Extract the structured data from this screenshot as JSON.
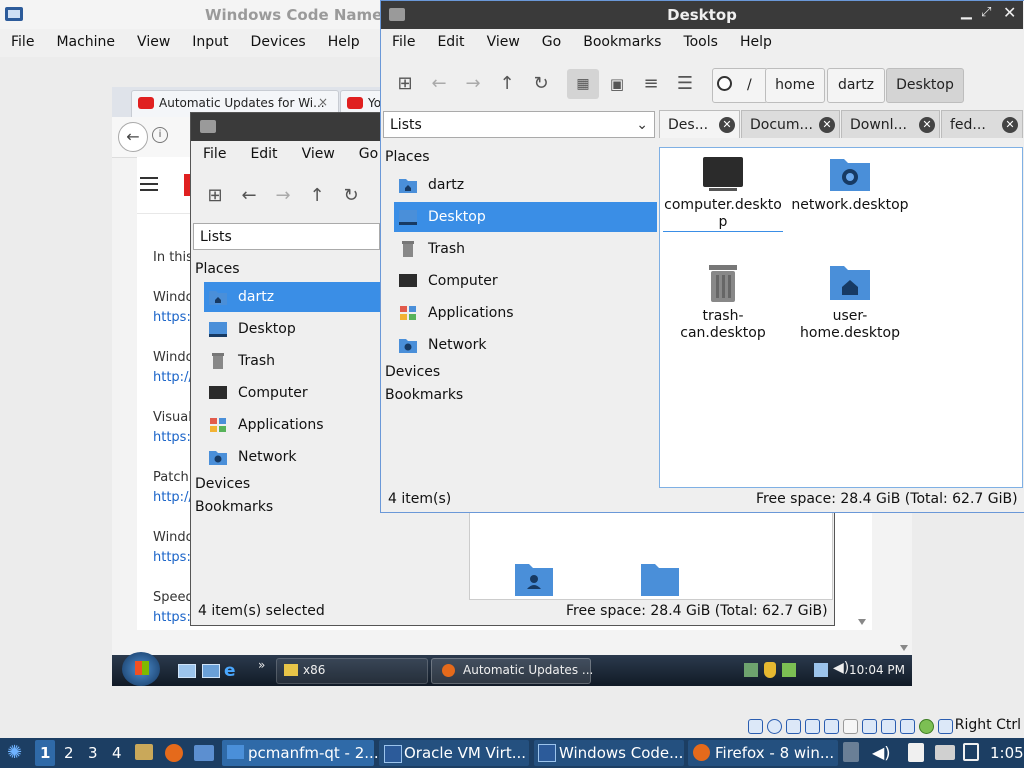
{
  "vbox": {
    "title": "Windows Code Name",
    "menu": [
      "File",
      "Machine",
      "View",
      "Input",
      "Devices",
      "Help"
    ],
    "status_right": "Right Ctrl"
  },
  "guest": {
    "firefox": {
      "tabs": [
        {
          "label": "Automatic Updates for Wi..."
        },
        {
          "label": "Yo"
        }
      ],
      "page_lines": [
        {
          "text": "In this",
          "kind": "text"
        },
        {
          "text": "Windo",
          "kind": "text"
        },
        {
          "text": "https:/",
          "kind": "link"
        },
        {
          "text": "Windo",
          "kind": "text"
        },
        {
          "text": "http://",
          "kind": "link"
        },
        {
          "text": "Visual",
          "kind": "text"
        },
        {
          "text": "https:/",
          "kind": "link"
        },
        {
          "text": "Patch",
          "kind": "text"
        },
        {
          "text": "http://",
          "kind": "link"
        },
        {
          "text": "Windo",
          "kind": "text"
        },
        {
          "text": "https:/",
          "kind": "link"
        },
        {
          "text": "Speed",
          "kind": "text"
        },
        {
          "text": "https:/",
          "kind": "link"
        }
      ]
    },
    "taskbar": {
      "folder_label": "x86",
      "firefox_label": "Automatic Updates ...",
      "time": "10:04 PM"
    }
  },
  "fm_back": {
    "menu": [
      "File",
      "Edit",
      "View",
      "Go"
    ],
    "places_combo": "Lists",
    "places_header": "Places",
    "places": [
      {
        "label": "dartz",
        "icon": "home-folder-icon",
        "selected": true
      },
      {
        "label": "Desktop",
        "icon": "desktop-icon",
        "selected": false
      },
      {
        "label": "Trash",
        "icon": "trash-icon",
        "selected": false
      },
      {
        "label": "Computer",
        "icon": "computer-icon",
        "selected": false
      },
      {
        "label": "Applications",
        "icon": "applications-icon",
        "selected": false
      },
      {
        "label": "Network",
        "icon": "network-icon",
        "selected": false
      }
    ],
    "devices": "Devices",
    "bookmarks": "Bookmarks",
    "status_left": "4 item(s) selected",
    "status_right": "Free space: 28.4 GiB (Total: 62.7 GiB)"
  },
  "fm_front": {
    "title": "Desktop",
    "menu": [
      "File",
      "Edit",
      "View",
      "Go",
      "Bookmarks",
      "Tools",
      "Help"
    ],
    "path": [
      "/",
      "home",
      "dartz",
      "Desktop"
    ],
    "places_combo": "Lists",
    "places_header": "Places",
    "places": [
      {
        "label": "dartz",
        "icon": "home-folder-icon",
        "selected": false
      },
      {
        "label": "Desktop",
        "icon": "desktop-icon",
        "selected": true
      },
      {
        "label": "Trash",
        "icon": "trash-icon",
        "selected": false
      },
      {
        "label": "Computer",
        "icon": "computer-icon",
        "selected": false
      },
      {
        "label": "Applications",
        "icon": "applications-icon",
        "selected": false
      },
      {
        "label": "Network",
        "icon": "network-icon",
        "selected": false
      }
    ],
    "devices": "Devices",
    "bookmarks": "Bookmarks",
    "tabs": [
      "Des...",
      "Docum...",
      "Downl...",
      "fed..."
    ],
    "files": [
      {
        "label_lines": [
          "computer.deskto",
          "p"
        ],
        "icon": "computer-icon"
      },
      {
        "label_lines": [
          "network.desktop"
        ],
        "icon": "network-folder-icon"
      },
      {
        "label_lines": [
          "trash-",
          "can.desktop"
        ],
        "icon": "trash-icon"
      },
      {
        "label_lines": [
          "user-",
          "home.desktop"
        ],
        "icon": "home-folder-icon"
      }
    ],
    "status_left": "4 item(s)",
    "status_right": "Free space: 28.4 GiB (Total: 62.7 GiB)"
  },
  "host_taskbar": {
    "workspaces": [
      "1",
      "2",
      "3",
      "4"
    ],
    "tasks": [
      {
        "label": "pcmanfm-qt - 2..."
      },
      {
        "label": "Oracle VM Virt..."
      },
      {
        "label": "Windows Code..."
      },
      {
        "label": "Firefox - 8 win..."
      }
    ],
    "clock": "1:05"
  },
  "colors": {
    "selection": "#3a8ee6",
    "titlebar": "#3a3a3a",
    "host_taskbar": "#1c3e63",
    "folder_blue": "#4a8fd9"
  }
}
